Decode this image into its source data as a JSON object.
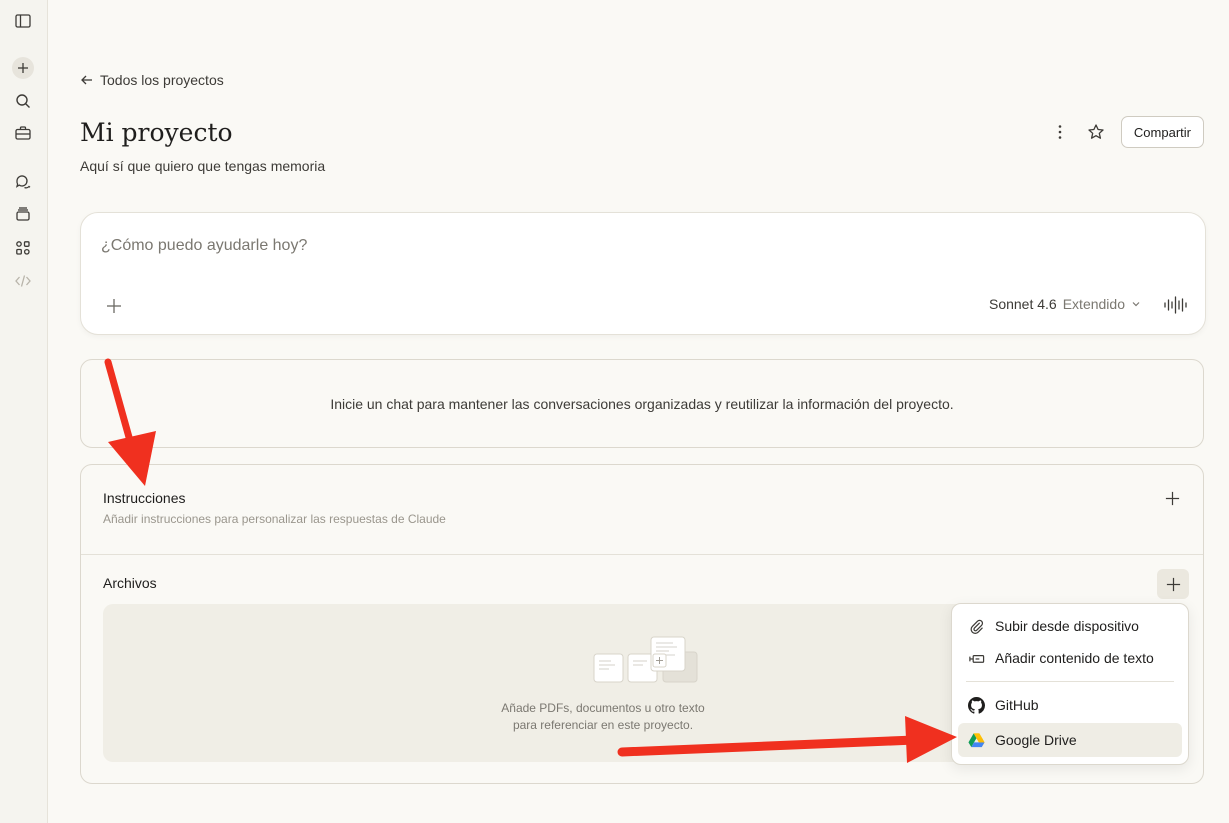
{
  "nav": {
    "back_label": "Todos los proyectos"
  },
  "project": {
    "title": "Mi proyecto",
    "description": "Aquí sí que quiero que tengas memoria",
    "share_label": "Compartir"
  },
  "composer": {
    "placeholder": "¿Cómo puedo ayudarle hoy?",
    "model_name": "Sonnet 4.6",
    "model_mode": "Extendido"
  },
  "info": {
    "text": "Inicie un chat para mantener las conversaciones organizadas y reutilizar la información del proyecto."
  },
  "instructions": {
    "title": "Instrucciones",
    "subtitle": "Añadir instrucciones para personalizar las respuestas de Claude"
  },
  "files": {
    "title": "Archivos",
    "empty_line1": "Añade PDFs, documentos u otro texto",
    "empty_line2": "para referenciar en este proyecto."
  },
  "menu": {
    "items": [
      {
        "label": "Subir desde dispositivo",
        "icon": "paperclip-icon"
      },
      {
        "label": "Añadir contenido de texto",
        "icon": "text-content-icon"
      },
      {
        "label": "GitHub",
        "icon": "github-icon"
      },
      {
        "label": "Google Drive",
        "icon": "google-drive-icon"
      }
    ]
  },
  "colors": {
    "background": "#faf9f5",
    "annotation_arrow": "#f0301f"
  }
}
